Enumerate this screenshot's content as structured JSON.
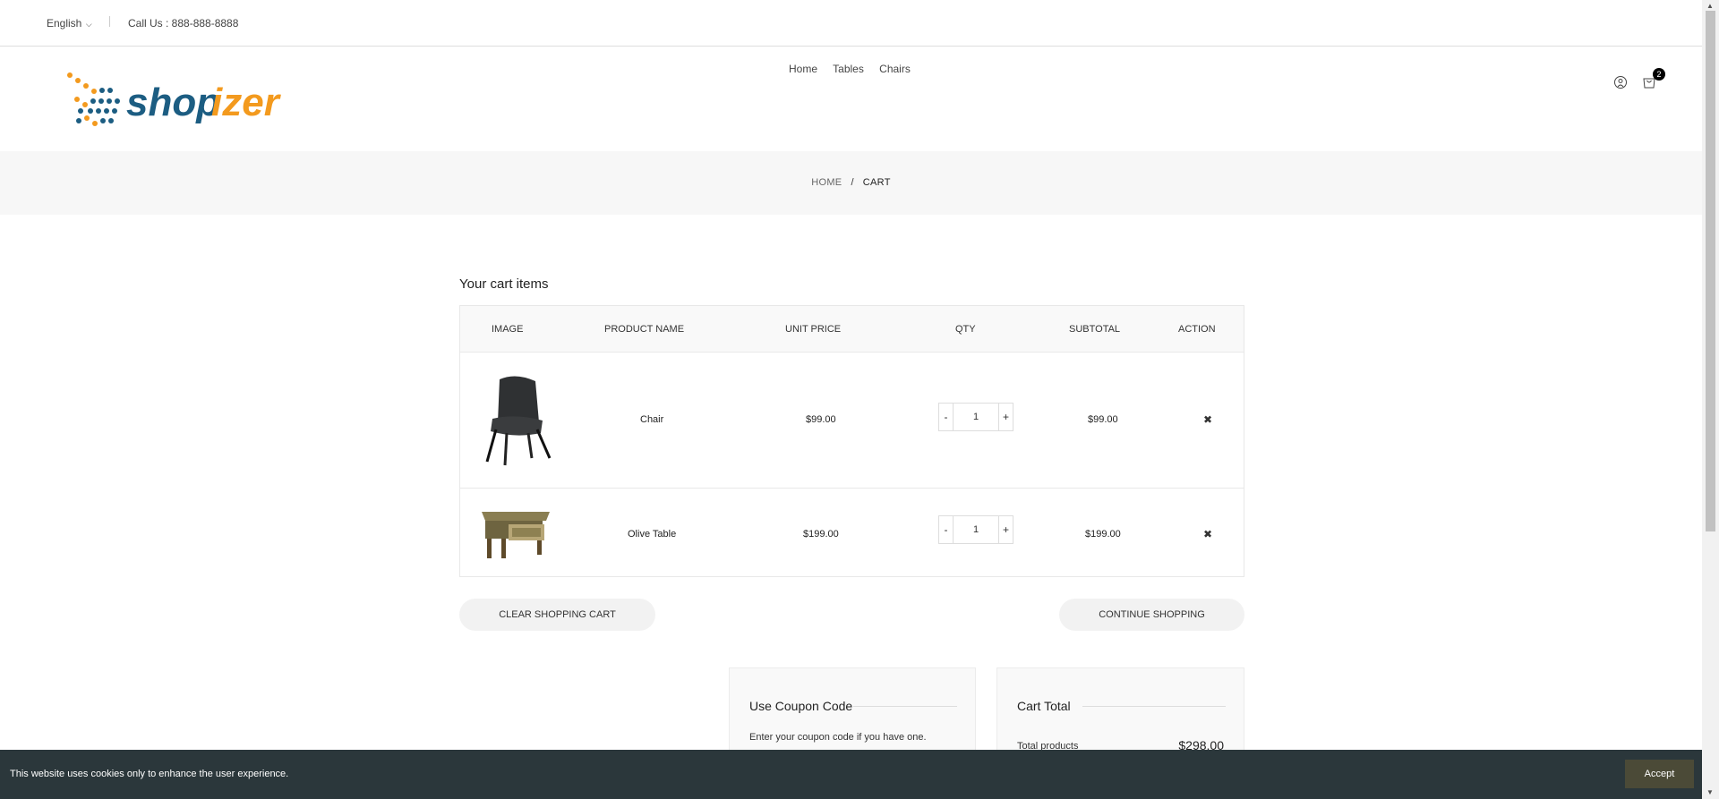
{
  "topbar": {
    "language": "English",
    "call": "Call Us : 888-888-8888"
  },
  "nav": {
    "items": [
      "Home",
      "Tables",
      "Chairs"
    ]
  },
  "header": {
    "logo_text": "shopizer",
    "cart_count": "2"
  },
  "breadcrumb": {
    "home": "HOME",
    "sep": "/",
    "current": "CART"
  },
  "cart": {
    "title": "Your cart items",
    "headers": [
      "IMAGE",
      "PRODUCT NAME",
      "UNIT PRICE",
      "QTY",
      "SUBTOTAL",
      "ACTION"
    ],
    "items": [
      {
        "name": "Chair",
        "price": "$99.00",
        "qty": "1",
        "subtotal": "$99.00"
      },
      {
        "name": "Olive Table",
        "price": "$199.00",
        "qty": "1",
        "subtotal": "$199.00"
      }
    ],
    "minus": "-",
    "plus": "+",
    "remove": "✖",
    "clear_label": "CLEAR SHOPPING CART",
    "continue_label": "CONTINUE SHOPPING"
  },
  "coupon": {
    "title": "Use Coupon Code",
    "text": "Enter your coupon code if you have one."
  },
  "total": {
    "title": "Cart Total",
    "products_label": "Total products",
    "products_value": "$298.00"
  },
  "cookie": {
    "message": "This website uses cookies only to enhance the user experience.",
    "accept": "Accept"
  },
  "colors": {
    "logo_blue": "#1c5d82",
    "logo_orange": "#f39a1e",
    "cookie_bg": "#2b373b",
    "accept_bg": "#4b4a37"
  }
}
